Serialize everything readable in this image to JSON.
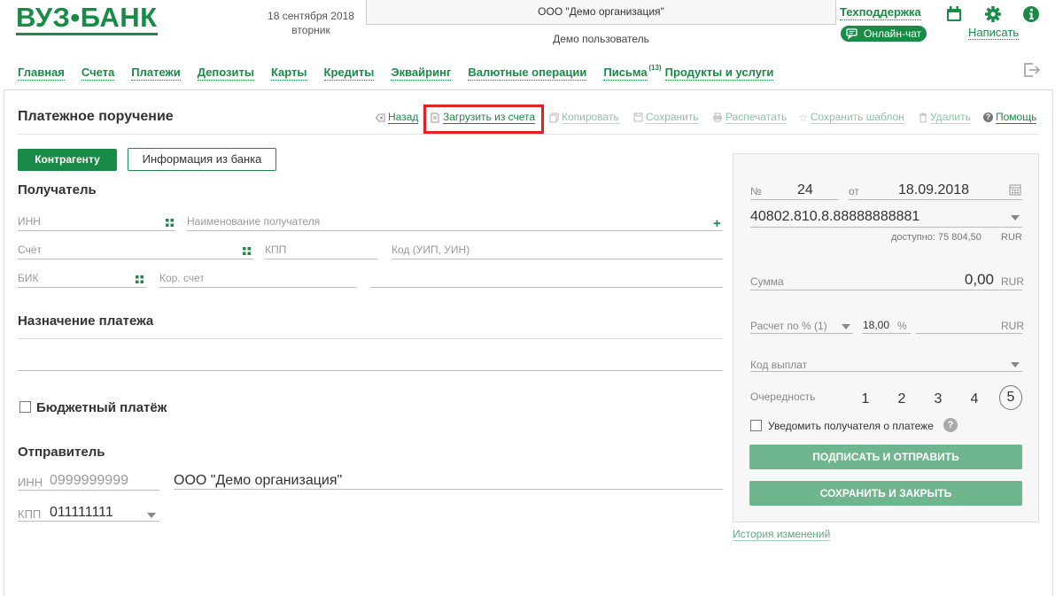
{
  "header": {
    "logo_text": "ВУЗ•БАНК",
    "date_line1": "18 сентября 2018",
    "date_line2": "вторник",
    "organization": "ООО \"Демо организация\"",
    "user": "Демо пользователь",
    "support": "Техподдержка",
    "chat": "Онлайн-чат",
    "write": "Написать",
    "icons": [
      "calendar-icon",
      "gear-icon",
      "info-icon",
      "exit-icon"
    ]
  },
  "nav": {
    "items": [
      {
        "label": "Главная"
      },
      {
        "label": "Счета"
      },
      {
        "label": "Платежи"
      },
      {
        "label": "Депозиты"
      },
      {
        "label": "Карты"
      },
      {
        "label": "Кредиты"
      },
      {
        "label": "Эквайринг"
      },
      {
        "label": "Валютные операции"
      },
      {
        "label": "Письма",
        "badge": "(13)"
      },
      {
        "label": "Продукты и услуги"
      }
    ]
  },
  "page": {
    "title": "Платежное поручение"
  },
  "toolbar": {
    "back": "Назад",
    "load": "Загрузить из счета",
    "copy": "Копировать",
    "save": "Сохранить",
    "print": "Распечатать",
    "save_template": "Сохранить шаблон",
    "delete": "Удалить",
    "help": "Помощь"
  },
  "tabs": {
    "counterparty": "Контрагенту",
    "bank_info": "Информация из банка"
  },
  "recipient": {
    "heading": "Получатель",
    "inn_placeholder": "ИНН",
    "name_placeholder": "Наименование получателя",
    "account_placeholder": "Счёт",
    "kpp_placeholder": "КПП",
    "code_placeholder": "Код (УИП, УИН)",
    "bik_placeholder": "БИК",
    "corr_placeholder": "Кор. счет"
  },
  "purpose": {
    "heading": "Назначение платежа"
  },
  "budget": {
    "label": "Бюджетный платёж"
  },
  "sender": {
    "heading": "Отправитель",
    "inn_label": "ИНН",
    "inn_value": "0999999999",
    "name": "ООО \"Демо организация\"",
    "kpp_label": "КПП",
    "kpp_value": "011111111"
  },
  "doc": {
    "number_label": "№",
    "number": "24",
    "date_label": "от",
    "date": "18.09.2018",
    "account": "40802.810.8.88888888881",
    "available": "доступно: 75 804,50",
    "available_currency": "RUR",
    "sum_label": "Сумма",
    "sum": "0,00",
    "sum_currency": "RUR",
    "vat_label": "Расчет по % (1)",
    "vat_rate": "18,00",
    "vat_percent": "%",
    "vat_currency": "RUR",
    "payout_code_label": "Код выплат",
    "priority_label": "Очередность",
    "priorities": [
      "1",
      "2",
      "3",
      "4",
      "5"
    ],
    "selected_priority": "5",
    "notify_label": "Уведомить получателя о платеже",
    "sign_send": "ПОДПИСАТЬ И ОТПРАВИТЬ",
    "save_close": "СОХРАНИТЬ И ЗАКРЫТЬ",
    "history": "История изменений"
  },
  "colors": {
    "brand": "#1a8a47",
    "highlight": "#e32121",
    "button_muted": "#6fb58e"
  }
}
